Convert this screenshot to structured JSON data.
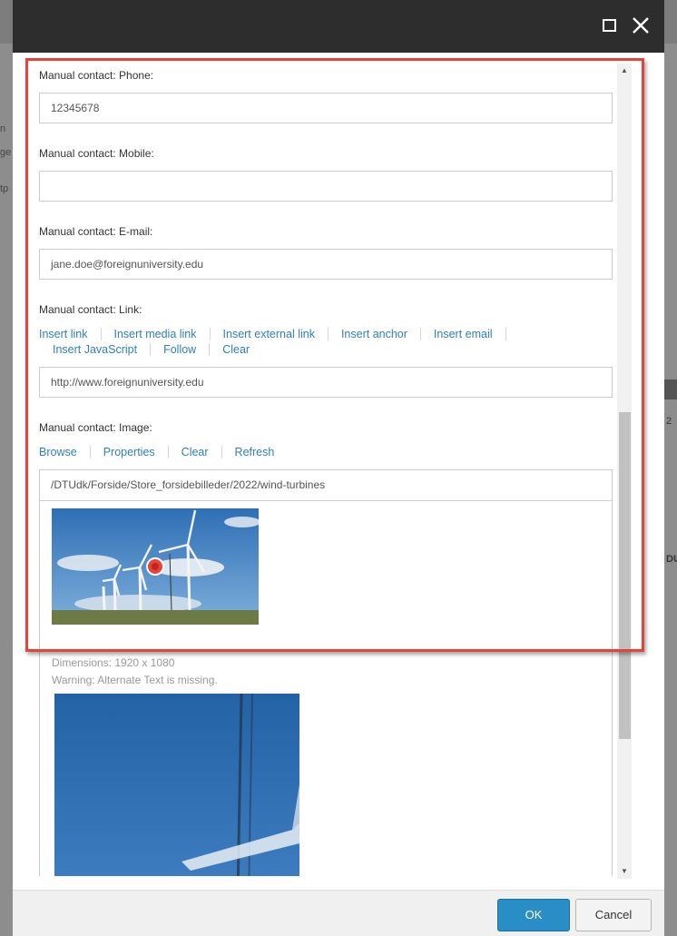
{
  "window": {
    "maximize_icon": "maximize-icon",
    "close_icon": "close-icon"
  },
  "background": {
    "left_fragments": [
      "n",
      "ge",
      "tp"
    ],
    "right_fragments": [
      "2",
      "DU"
    ]
  },
  "fields": {
    "phone": {
      "label": "Manual contact: Phone:",
      "value": "12345678"
    },
    "mobile": {
      "label": "Manual contact: Mobile:",
      "value": ""
    },
    "email": {
      "label": "Manual contact: E-mail:",
      "value": "jane.doe@foreignuniversity.edu"
    },
    "link": {
      "label": "Manual contact: Link:",
      "actions_row1": [
        "Insert link",
        "Insert media link",
        "Insert external link",
        "Insert anchor",
        "Insert email"
      ],
      "actions_row2": [
        "Insert JavaScript",
        "Follow",
        "Clear"
      ],
      "value": "http://www.foreignuniversity.edu"
    },
    "image": {
      "label": "Manual contact: Image:",
      "actions": [
        "Browse",
        "Properties",
        "Clear",
        "Refresh"
      ],
      "path": "/DTUdk/Forside/Store_forsidebilleder/2022/wind-turbines",
      "dimensions": "Dimensions: 1920 x 1080",
      "warning": "Warning: Alternate Text is missing."
    }
  },
  "footer": {
    "ok_label": "OK",
    "cancel_label": "Cancel"
  },
  "colors": {
    "accent": "#2a8ec6",
    "link": "#2e80b9",
    "highlight": "#e8433a",
    "titlebar": "#2d2d2d"
  }
}
